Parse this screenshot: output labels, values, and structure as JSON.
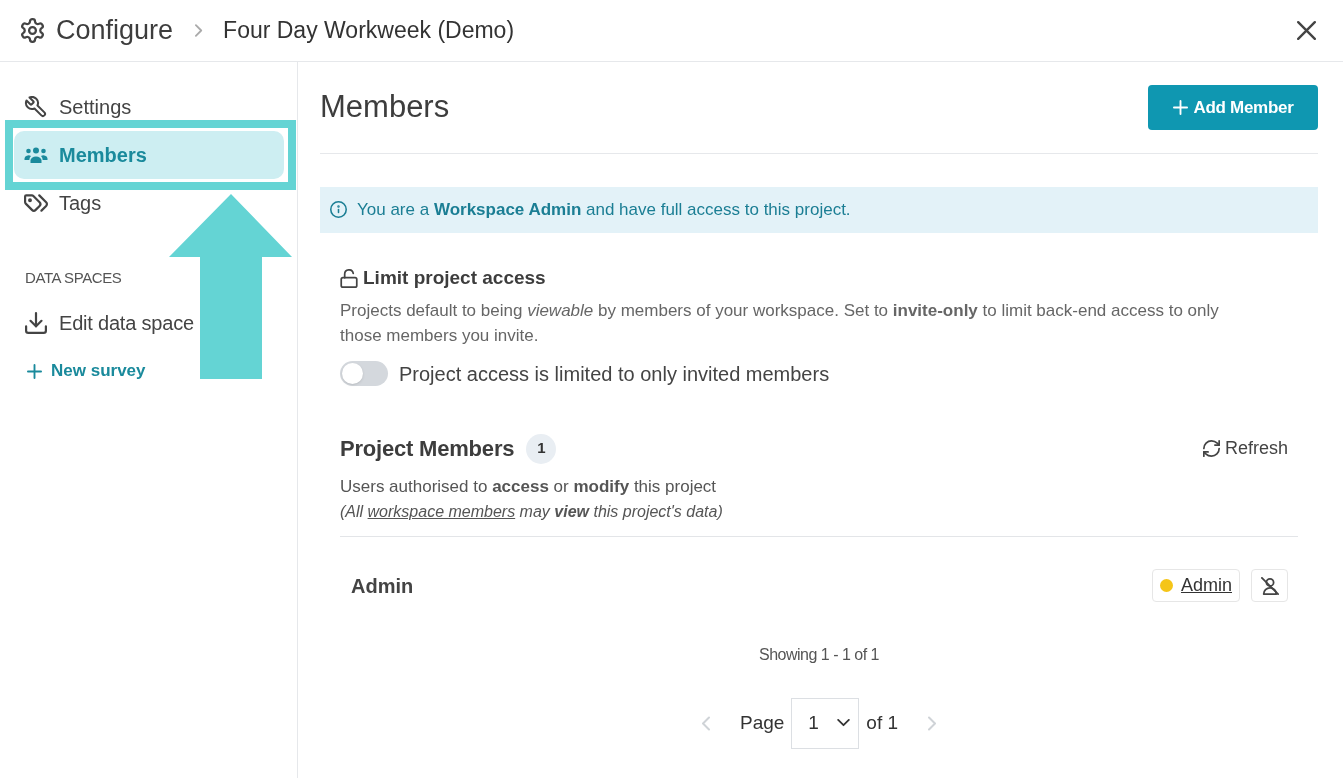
{
  "header": {
    "title": "Configure",
    "breadcrumb": "Four Day Workweek (Demo)"
  },
  "sidebar": {
    "items": [
      {
        "label": "Settings",
        "selected": false
      },
      {
        "label": "Members",
        "selected": true
      },
      {
        "label": "Tags",
        "selected": false
      }
    ],
    "section_title": "DATA SPACES",
    "data_space_items": [
      {
        "label": "Edit data space"
      }
    ],
    "new_link": "New survey"
  },
  "main": {
    "title": "Members",
    "add_button": "Add Member",
    "info_banner": "You are a **Workspace Admin** and have full access to this project.",
    "access": {
      "title": "Limit project access",
      "description": "Projects default to being *viewable* by members of your workspace. Set to **invite-only** to limit back-end access to only those members you invite.",
      "toggle": {
        "label": "Project access is limited to only invited members",
        "on": false
      }
    },
    "members": {
      "title": "Project Members",
      "count": "1",
      "refresh_button": "Refresh",
      "description": "Users authorised to **access** or **modify** this project",
      "note": {
        "before": "(All ",
        "link": "workspace members",
        "after": " may **view** this project's data)"
      },
      "rows": [
        {
          "name": "Admin",
          "role": "Admin",
          "color": "#f5c518"
        }
      ]
    },
    "pagination": {
      "summary": "Showing 1 - 1 of 1",
      "page_label": "Page",
      "page": "1",
      "total": "of 1",
      "prev_disabled": true,
      "next_disabled": true
    }
  }
}
